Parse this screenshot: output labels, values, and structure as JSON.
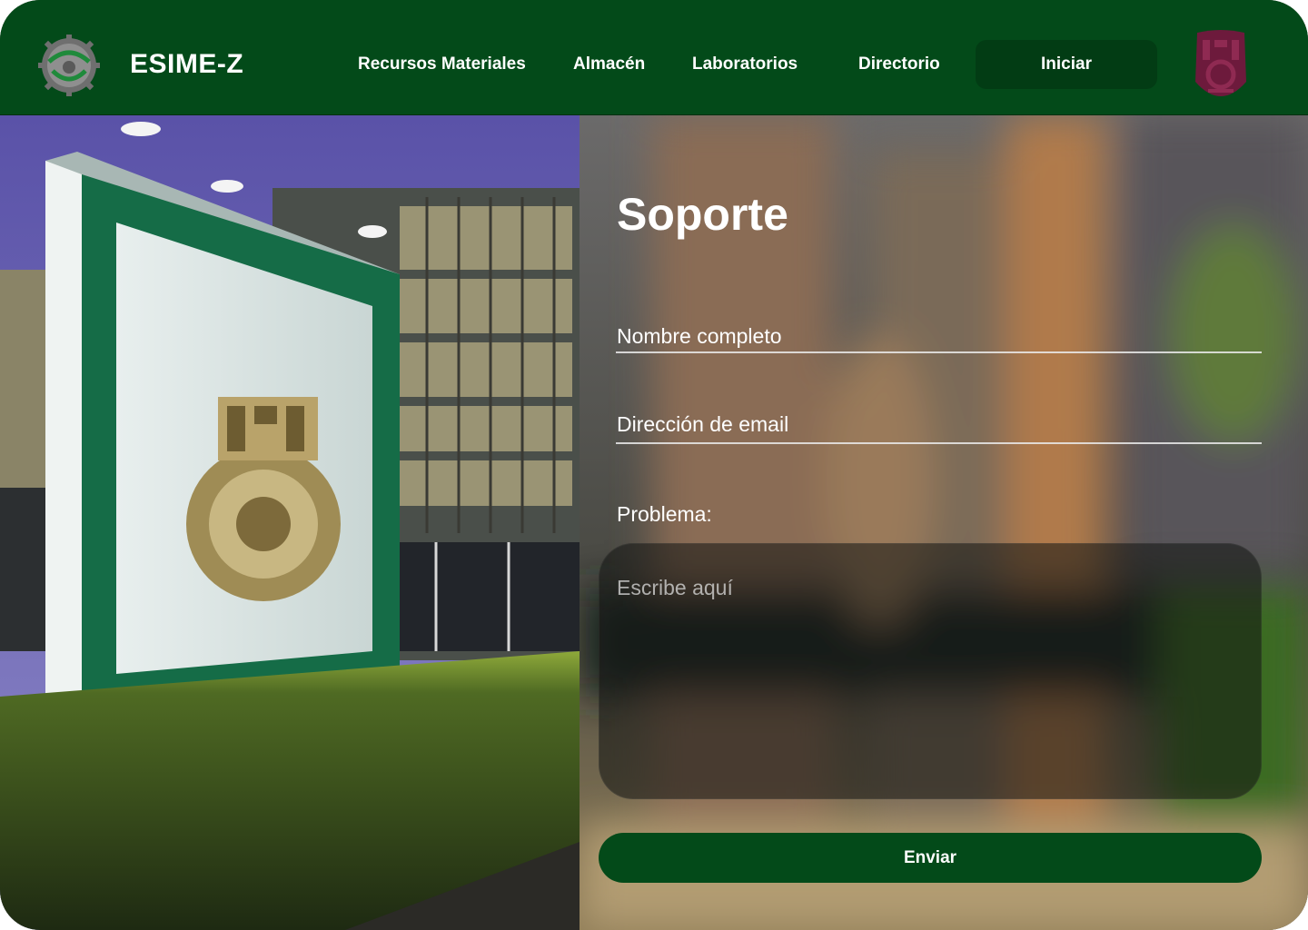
{
  "navbar": {
    "brand": "ESIME-Z",
    "links": [
      "Recursos Materiales",
      "Almacén",
      "Laboratorios",
      "Directorio"
    ],
    "login_button": "Iniciar",
    "logos": {
      "left": "esime-logo-icon",
      "right": "ipn-logo-icon"
    }
  },
  "hero": {
    "image": "ipn-monument-photo"
  },
  "form": {
    "title": "Soporte",
    "name_label": "Nombre completo",
    "email_label": "Dirección de email",
    "problem_label": "Problema:",
    "problem_placeholder": "Escribe aquí",
    "submit_label": "Enviar"
  },
  "colors": {
    "primary_green": "#034a19",
    "dark_green": "#023c14",
    "ipn_maroon": "#6d1a3c",
    "text_white": "#ffffff"
  }
}
